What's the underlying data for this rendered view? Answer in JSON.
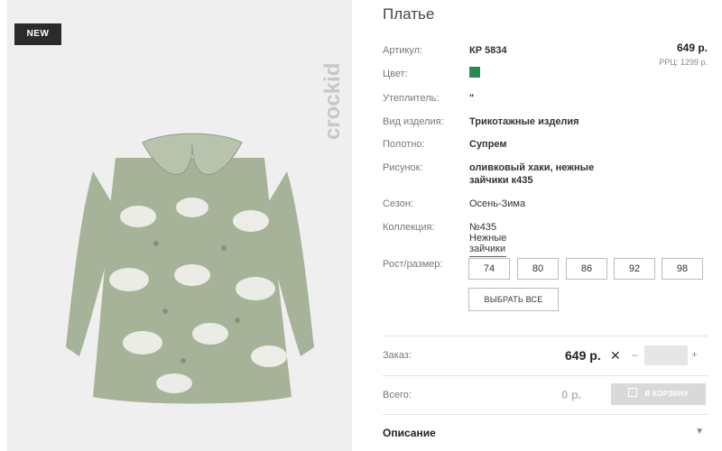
{
  "badge": "NEW",
  "brand": "crockid",
  "title": "Платье",
  "rows": {
    "article": {
      "label": "Артикул:",
      "value": "КР 5834"
    },
    "color": {
      "label": "Цвет:",
      "swatch": "#1f8f4f"
    },
    "insulation": {
      "label": "Утеплитель:",
      "value": "\""
    },
    "product_type": {
      "label": "Вид изделия:",
      "value": "Трикотажные изделия"
    },
    "fabric": {
      "label": "Полотно:",
      "value": "Супрем"
    },
    "pattern": {
      "label": "Рисунок:",
      "value_line1": "оливковый хаки, нежные",
      "value_line2": "зайчики к435"
    },
    "season": {
      "label": "Сезон:",
      "value": "Осень-Зима"
    },
    "collection": {
      "label": "Коллекция:",
      "value": "№435 Нежные зайчики"
    }
  },
  "price": "649 р.",
  "rrp": "РРЦ: 1299 р.",
  "size_label": "Рост/размер:",
  "sizes": [
    "74",
    "80",
    "86",
    "92",
    "98"
  ],
  "select_all": "ВЫБРАТЬ ВСЕ",
  "order": {
    "label": "Заказ:",
    "price": "649 р.",
    "x": "✕",
    "minus": "–",
    "plus": "+"
  },
  "total": {
    "label": "Всего:",
    "value": "0 р."
  },
  "cart_button": "В КОРЗИНУ",
  "description": "Описание",
  "colors": {
    "swatch": "#1f8f4f",
    "dress": "#a7b398"
  }
}
